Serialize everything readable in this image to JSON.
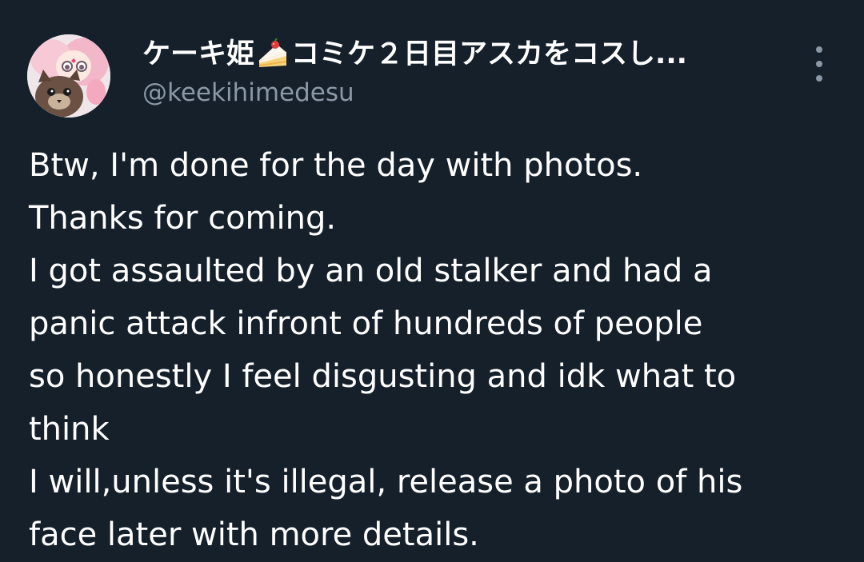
{
  "author": {
    "display_name_prefix": "ケーキ姫",
    "display_name_suffix": "コミケ２日目アスカをコスし...",
    "name_emoji": "cake-icon",
    "handle": "@keekihimedesu",
    "avatar": "avatar-illustration"
  },
  "more_menu": {
    "icon": "more-vertical-icon"
  },
  "tweet": {
    "lines": [
      "Btw, I'm done for the day with photos.",
      "Thanks for coming.",
      "I got assaulted by an old stalker and had a",
      "panic attack infront of hundreds of people",
      "so honestly I feel disgusting and idk what to",
      "think",
      "I will,unless it's illegal, release a photo of his",
      "face later with more details."
    ]
  },
  "colors": {
    "background": "#15202b",
    "text_primary": "#ffffff",
    "text_secondary": "#8b98a5"
  }
}
